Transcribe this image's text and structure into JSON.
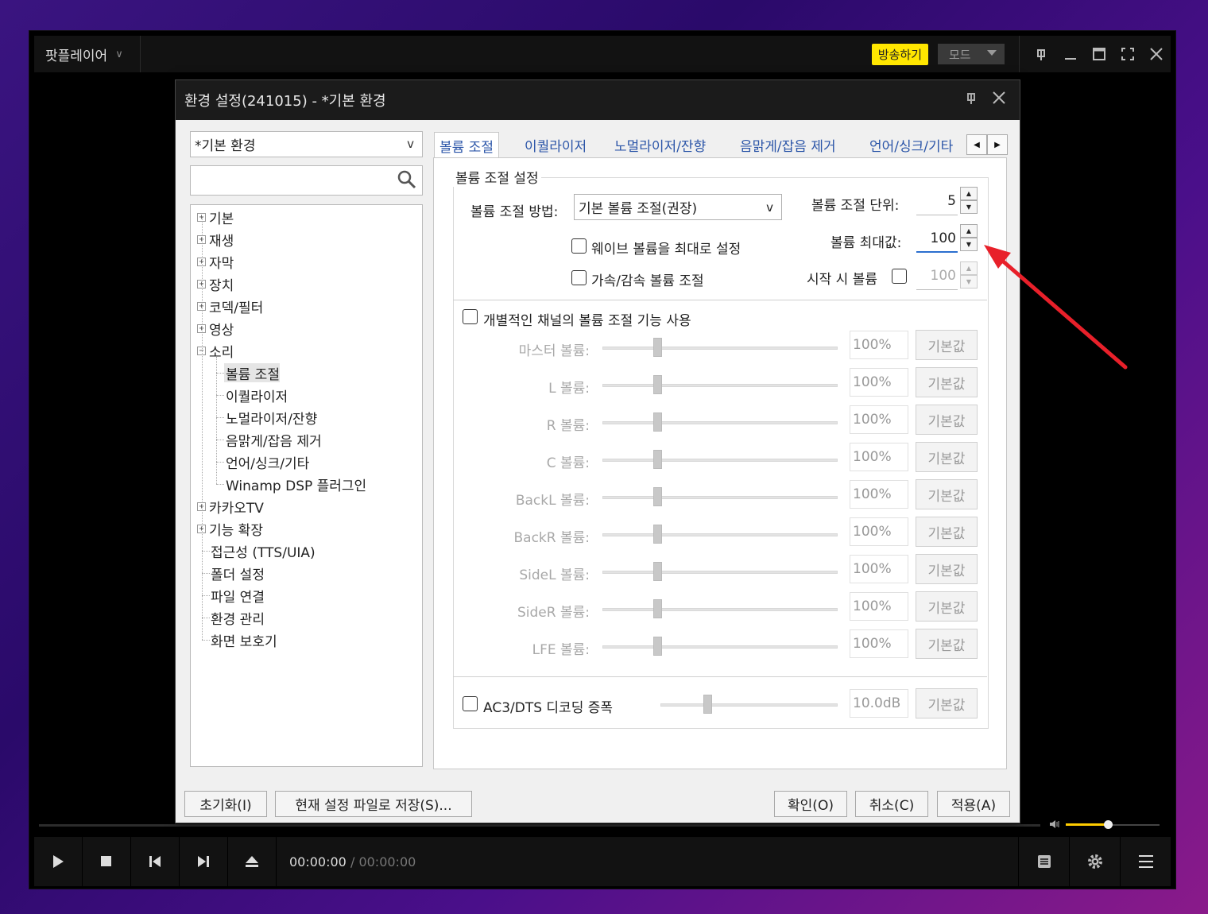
{
  "player": {
    "app_name": "팟플레이어",
    "broadcast_label": "방송하기",
    "mode_label": "모드",
    "time_current": "00:00:00",
    "time_separator": "/",
    "time_total": "00:00:00",
    "volume_level": 0.45
  },
  "dialog": {
    "title": "환경 설정(241015) - *기본 환경",
    "profile": "*기본 환경",
    "search_placeholder": "",
    "tree": [
      {
        "label": "기본",
        "expanded": false
      },
      {
        "label": "재생",
        "expanded": false
      },
      {
        "label": "자막",
        "expanded": false
      },
      {
        "label": "장치",
        "expanded": false
      },
      {
        "label": "코덱/필터",
        "expanded": false
      },
      {
        "label": "영상",
        "expanded": false
      },
      {
        "label": "소리",
        "expanded": true
      },
      {
        "label": "볼륨 조절",
        "child": true,
        "selected": true
      },
      {
        "label": "이퀄라이저",
        "child": true
      },
      {
        "label": "노멀라이저/잔향",
        "child": true
      },
      {
        "label": "음맑게/잡음 제거",
        "child": true
      },
      {
        "label": "언어/싱크/기타",
        "child": true
      },
      {
        "label": "Winamp DSP 플러그인",
        "child": true
      },
      {
        "label": "카카오TV",
        "expanded": false
      },
      {
        "label": "기능 확장",
        "expanded": false
      },
      {
        "label": "접근성 (TTS/UIA)"
      },
      {
        "label": "폴더 설정"
      },
      {
        "label": "파일 연결"
      },
      {
        "label": "환경 관리"
      },
      {
        "label": "화면 보호기"
      }
    ],
    "tabs": [
      "볼륨 조절",
      "이퀄라이저",
      "노멀라이저/잔향",
      "음맑게/잡음 제거",
      "언어/싱크/기타"
    ],
    "group_title": "볼륨 조절 설정",
    "method_label": "볼륨 조절 방법:",
    "method_value": "기본 볼륨 조절(권장)",
    "unit_label": "볼륨 조절 단위:",
    "unit_value": "5",
    "max_label": "볼륨 최대값:",
    "max_value": "100",
    "start_label": "시작 시 볼륨",
    "start_value": "100",
    "wave_label": "웨이브 볼륨을 최대로 설정",
    "accel_label": "가속/감속 볼륨 조절",
    "per_channel_label": "개별적인 채널의 볼륨 조절 기능 사용",
    "channels": [
      {
        "label": "마스터 볼륨:",
        "value": "100%",
        "level": 0.22
      },
      {
        "label": "L 볼륨:",
        "value": "100%",
        "level": 0.22
      },
      {
        "label": "R 볼륨:",
        "value": "100%",
        "level": 0.22
      },
      {
        "label": "C 볼륨:",
        "value": "100%",
        "level": 0.22
      },
      {
        "label": "BackL 볼륨:",
        "value": "100%",
        "level": 0.22
      },
      {
        "label": "BackR 볼륨:",
        "value": "100%",
        "level": 0.22
      },
      {
        "label": "SideL 볼륨:",
        "value": "100%",
        "level": 0.22
      },
      {
        "label": "SideR 볼륨:",
        "value": "100%",
        "level": 0.22
      },
      {
        "label": "LFE 볼륨:",
        "value": "100%",
        "level": 0.22
      }
    ],
    "default_label": "기본값",
    "ac3_label": "AC3/DTS 디코딩 증폭",
    "ac3_value": "10.0dB",
    "ac3_level": 0.25,
    "buttons": {
      "reset": "초기화(I)",
      "save_file": "현재 설정 파일로 저장(S)...",
      "ok": "확인(O)",
      "cancel": "취소(C)",
      "apply": "적용(A)"
    }
  },
  "colors": {
    "broadcast_bg": "#ffe600",
    "volume_accent": "#ffcc00",
    "annotation_arrow": "#e8202a",
    "tab_text": "#2b55a8"
  }
}
